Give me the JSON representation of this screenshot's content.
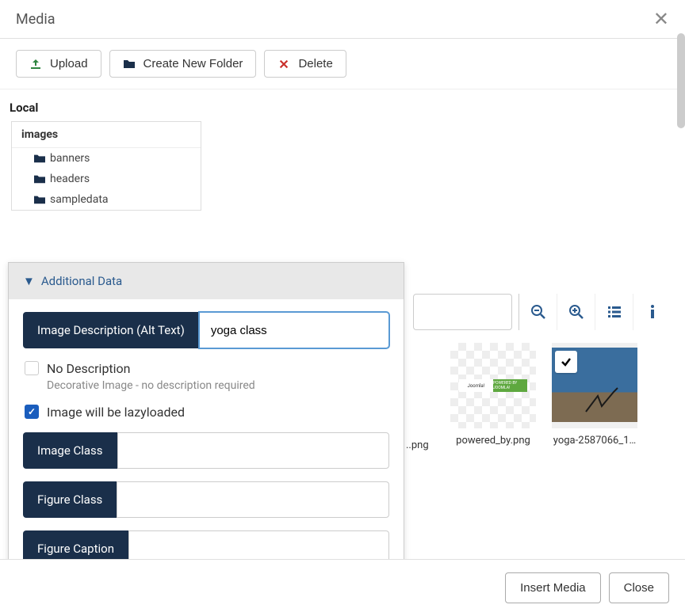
{
  "modalTitle": "Media",
  "toolbar": {
    "upload": "Upload",
    "createFolder": "Create New Folder",
    "delete": "Delete"
  },
  "sidebar": {
    "localLabel": "Local",
    "root": "images",
    "folders": [
      "banners",
      "headers",
      "sampledata"
    ]
  },
  "popup": {
    "title": "Additional Data",
    "altLabel": "Image Description (Alt Text)",
    "altValue": "yoga class",
    "noDescLabel": "No Description",
    "noDescSub": "Decorative Image - no description required",
    "noDescChecked": false,
    "lazyLabel": "Image will be lazyloaded",
    "lazyChecked": true,
    "imageClassLabel": "Image Class",
    "imageClassValue": "",
    "figureClassLabel": "Figure Class",
    "figureClassValue": "",
    "figureCaptionLabel": "Figure Caption",
    "figureCaptionValue": ""
  },
  "thumbs": {
    "partial": "..png",
    "powered": "powered_by.png",
    "yoga": "yoga-2587066_1…",
    "joomlaLeft": "Joomla!",
    "joomlaRight": "POWERED BY JOOMLA!"
  },
  "footer": {
    "insert": "Insert Media",
    "close": "Close"
  }
}
